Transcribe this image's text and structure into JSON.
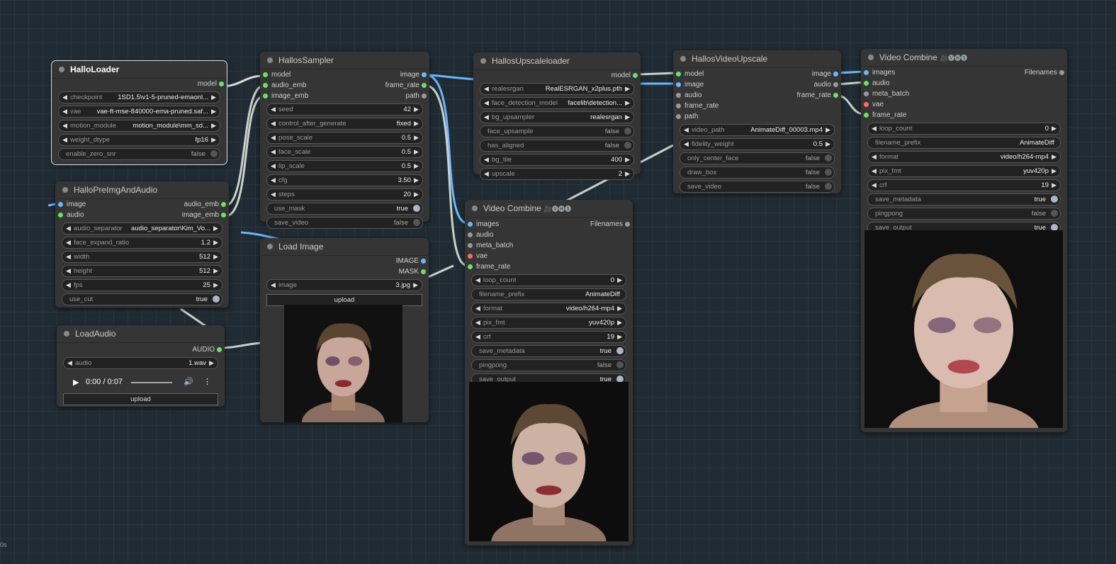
{
  "nodes": {
    "halloloader": {
      "title": "HalloLoader",
      "outputs": [
        "model"
      ],
      "widgets": [
        {
          "label": "checkpoint",
          "value": "1SD1.5\\v1-5-pruned-emaonl..."
        },
        {
          "label": "vae",
          "value": "vae-ft-mse-840000-ema-pruned.saf..."
        },
        {
          "label": "motion_module",
          "value": "motion_module\\mm_sd..."
        },
        {
          "label": "weight_dtype",
          "value": "fp16"
        },
        {
          "label": "enable_zero_snr",
          "value": "false"
        }
      ]
    },
    "halloprep": {
      "title": "HalloPreImgAndAudio",
      "inputs": [
        "image",
        "audio"
      ],
      "outputs": [
        "audio_emb",
        "image_emb"
      ],
      "widgets": [
        {
          "label": "audio_separator",
          "value": "audio_separator\\Kim_Vo..."
        },
        {
          "label": "face_expand_ratio",
          "value": "1.2"
        },
        {
          "label": "width",
          "value": "512"
        },
        {
          "label": "height",
          "value": "512"
        },
        {
          "label": "fps",
          "value": "25"
        },
        {
          "label": "use_cut",
          "value": "true"
        }
      ]
    },
    "loadaudio": {
      "title": "LoadAudio",
      "outputs": [
        "AUDIO"
      ],
      "widgets": [
        {
          "label": "audio",
          "value": "1.wav"
        }
      ],
      "player_time": "0:00 / 0:07",
      "upload": "upload"
    },
    "sampler": {
      "title": "HallosSampler",
      "inputs": [
        "model",
        "audio_emb",
        "image_emb"
      ],
      "outputs": [
        "image",
        "frame_rate",
        "path"
      ],
      "widgets": [
        {
          "label": "seed",
          "value": "42"
        },
        {
          "label": "control_after_generate",
          "value": "fixed"
        },
        {
          "label": "pose_scale",
          "value": "0.5"
        },
        {
          "label": "face_scale",
          "value": "0.5"
        },
        {
          "label": "lip_scale",
          "value": "0.5"
        },
        {
          "label": "cfg",
          "value": "3.50"
        },
        {
          "label": "steps",
          "value": "20"
        },
        {
          "label": "use_mask",
          "value": "true"
        },
        {
          "label": "save_video",
          "value": "false"
        }
      ]
    },
    "loadimage": {
      "title": "Load Image",
      "outputs": [
        "IMAGE",
        "MASK"
      ],
      "widgets": [
        {
          "label": "image",
          "value": "3.jpg"
        }
      ],
      "upload": "upload"
    },
    "upscaleloader": {
      "title": "HallosUpscaleloader",
      "outputs": [
        "model"
      ],
      "widgets": [
        {
          "label": "realesrgan",
          "value": "RealESRGAN_x2plus.pth"
        },
        {
          "label": "face_detection_model",
          "value": "facelib\\detection..."
        },
        {
          "label": "bg_upsampler",
          "value": "realesrgan"
        },
        {
          "label": "face_upsample",
          "value": "false"
        },
        {
          "label": "has_aligned",
          "value": "false"
        },
        {
          "label": "bg_tile",
          "value": "400"
        },
        {
          "label": "upscale",
          "value": "2"
        }
      ]
    },
    "vcombine1": {
      "title": "Video Combine",
      "badge": "🎥🅥🅗🅢",
      "inputs": [
        "images",
        "audio",
        "meta_batch",
        "vae",
        "frame_rate"
      ],
      "outputs": [
        "Filenames"
      ],
      "widgets": [
        {
          "label": "loop_count",
          "value": "0"
        },
        {
          "label": "filename_prefix",
          "value": "AnimateDiff"
        },
        {
          "label": "format",
          "value": "video/h264-mp4"
        },
        {
          "label": "pix_fmt",
          "value": "yuv420p"
        },
        {
          "label": "crf",
          "value": "19"
        },
        {
          "label": "save_metadata",
          "value": "true"
        },
        {
          "label": "pingpong",
          "value": "false"
        },
        {
          "label": "save_output",
          "value": "true"
        }
      ]
    },
    "videoupscale": {
      "title": "HallosVideoUpscale",
      "inputs": [
        "model",
        "image",
        "audio",
        "frame_rate",
        "path"
      ],
      "outputs": [
        "image",
        "audio",
        "frame_rate"
      ],
      "widgets": [
        {
          "label": "video_path",
          "value": "AnimateDiff_00003.mp4"
        },
        {
          "label": "fidelity_weight",
          "value": "0.5"
        },
        {
          "label": "only_center_face",
          "value": "false"
        },
        {
          "label": "draw_box",
          "value": "false"
        },
        {
          "label": "save_video",
          "value": "false"
        }
      ]
    },
    "vcombine2": {
      "title": "Video Combine",
      "badge": "🎥🅥🅗🅢",
      "inputs": [
        "images",
        "audio",
        "meta_batch",
        "vae",
        "frame_rate"
      ],
      "outputs": [
        "Filenames"
      ],
      "widgets": [
        {
          "label": "loop_count",
          "value": "0"
        },
        {
          "label": "filename_prefix",
          "value": "AnimateDiff"
        },
        {
          "label": "format",
          "value": "video/h264-mp4"
        },
        {
          "label": "pix_fmt",
          "value": "yuv420p"
        },
        {
          "label": "crf",
          "value": "19"
        },
        {
          "label": "save_metadata",
          "value": "true"
        },
        {
          "label": "pingpong",
          "value": "false"
        },
        {
          "label": "save_output",
          "value": "true"
        }
      ]
    }
  },
  "status_text": "0s"
}
